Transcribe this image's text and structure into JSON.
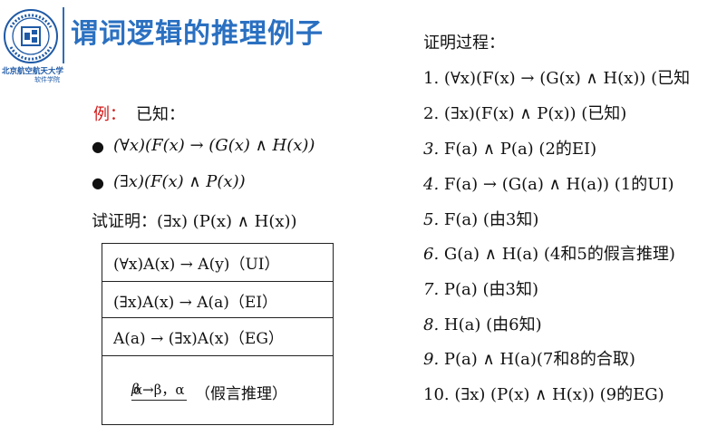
{
  "logo": {
    "seal_text": "北京航空航天大学",
    "school_name": "北京航空航天大学",
    "sub_name": "软件学院",
    "colors": {
      "seal": "#1f5aa6",
      "accent": "#2f6db5"
    }
  },
  "title": "谓词逻辑的推理例子",
  "example": {
    "label": "例：",
    "known": "已知：",
    "premise_1": "(∀x)(F(x) → (G(x) ∧ H(x))",
    "premise_2": "(∃x)(F(x) ∧ P(x))",
    "prove": "试证明：(∃x) (P(x) ∧ H(x))"
  },
  "rules": [
    "(∀x)A(x) → A(y)（UI）",
    "(∃x)A(x) → A(a)（EI）",
    "A(a) → (∃x)A(x)（EG）"
  ],
  "modus_ponens": {
    "numerator": "α→β，α",
    "denominator": "β",
    "name": "（假言推理）"
  },
  "proof": {
    "title": "证明过程：",
    "steps": [
      {
        "no": "1.",
        "text": "(∀x)(F(x) → (G(x) ∧ H(x)) (已知"
      },
      {
        "no": "2.",
        "text": "(∃x)(F(x) ∧ P(x)) (已知)"
      },
      {
        "no": "3.",
        "text": "F(a) ∧ P(a) (2的EI)"
      },
      {
        "no": "4.",
        "text": "F(a) → (G(a) ∧ H(a)) (1的UI)"
      },
      {
        "no": "5.",
        "text": "F(a) (由3知)"
      },
      {
        "no": "6.",
        "text": "G(a) ∧ H(a) (4和5的假言推理)"
      },
      {
        "no": "7.",
        "text": "P(a) (由3知)"
      },
      {
        "no": "8.",
        "text": "H(a) (由6知)"
      },
      {
        "no": "9.",
        "text": "P(a) ∧ H(a)(7和8的合取)"
      },
      {
        "no": "10.",
        "text": "(∃x) (P(x) ∧ H(x)) (9的EG)"
      }
    ]
  }
}
